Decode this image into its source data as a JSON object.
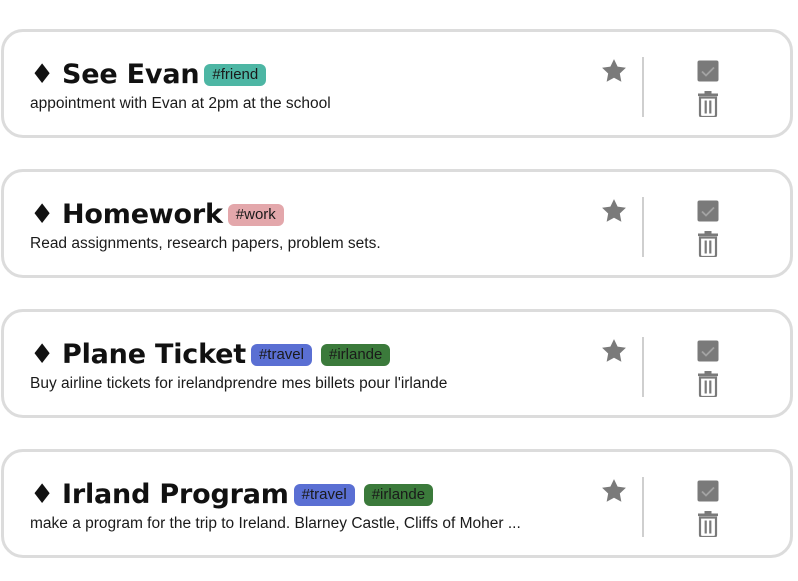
{
  "colors": {
    "card_border": "#dcdcdc",
    "icon_gray": "#7a7a7a",
    "tag_friend": "#4db6a4",
    "tag_work": "#e3a7ab",
    "tag_travel": "#5a6fd3",
    "tag_irlande": "#3b7a3b"
  },
  "icons": {
    "bullet": "black-diamond-bullet",
    "favorite": "star-icon",
    "complete": "checkbox-icon",
    "delete": "trash-icon"
  },
  "tasks": [
    {
      "bullet": "♦",
      "title": "See Evan",
      "tags": [
        {
          "label": "#friend",
          "color": "#4db6a4"
        }
      ],
      "description": "appointment with Evan at 2pm at the school"
    },
    {
      "bullet": "♦",
      "title": "Homework",
      "tags": [
        {
          "label": "#work",
          "color": "#e3a7ab"
        }
      ],
      "description": "Read assignments, research papers, problem sets."
    },
    {
      "bullet": "♦",
      "title": "Plane Ticket",
      "tags": [
        {
          "label": "#travel",
          "color": "#5a6fd3"
        },
        {
          "label": "#irlande",
          "color": "#3b7a3b"
        }
      ],
      "description": "Buy airline tickets for irelandprendre mes billets pour l'irlande"
    },
    {
      "bullet": "♦",
      "title": "Irland Program",
      "tags": [
        {
          "label": "#travel",
          "color": "#5a6fd3"
        },
        {
          "label": "#irlande",
          "color": "#3b7a3b"
        }
      ],
      "description": "make a program for the trip to Ireland. Blarney Castle, Cliffs of Moher ..."
    }
  ]
}
